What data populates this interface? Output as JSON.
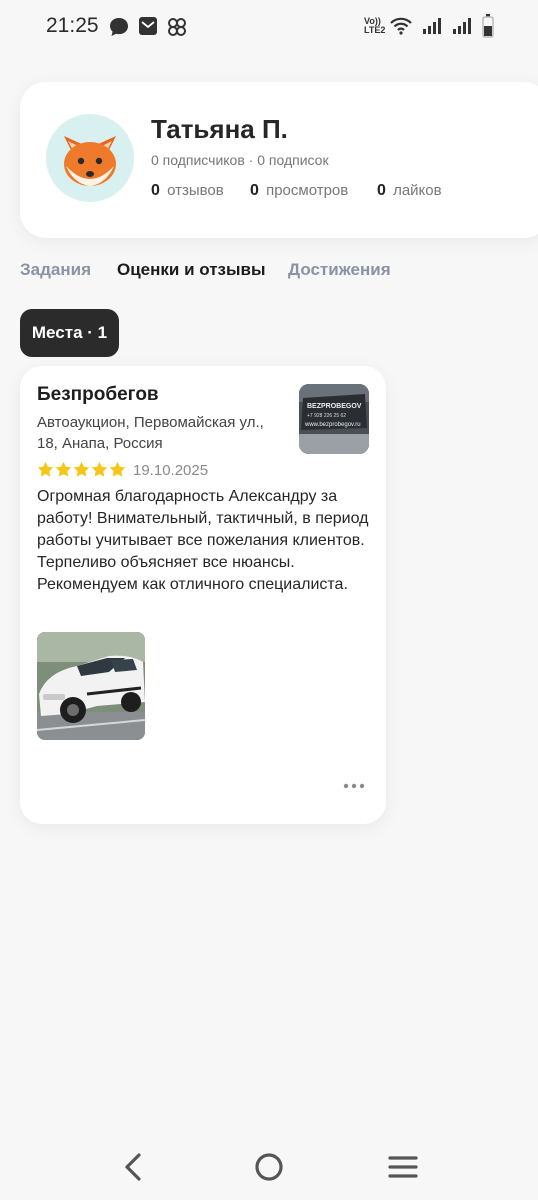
{
  "status_bar": {
    "time": "21:25",
    "left_icons": [
      "message-icon",
      "mail-icon",
      "app-icon"
    ],
    "right_icons": [
      "volte-icon",
      "wifi-icon",
      "signal-icon",
      "signal-icon",
      "battery-icon"
    ],
    "network_label_top": "Vo))",
    "network_label_bottom": "LTE2"
  },
  "profile": {
    "name": "Татьяна П.",
    "followers_line": "0 подписчиков · 0 подписок",
    "stats": [
      {
        "value": "0",
        "label": "отзывов"
      },
      {
        "value": "0",
        "label": "просмотров"
      },
      {
        "value": "0",
        "label": "лайков"
      }
    ],
    "avatar_icon": "fox-icon"
  },
  "tabs": [
    {
      "label": "Задания",
      "active": false
    },
    {
      "label": "Оценки и отзывы",
      "active": true
    },
    {
      "label": "Достижения",
      "active": false
    }
  ],
  "chip": {
    "label": "Места · 1"
  },
  "review": {
    "place_title": "Безпробегов",
    "address": "Автоаукцион, Первомайская ул., 18, Анапа, Россия",
    "rating": 5,
    "date": "19.10.2025",
    "text": "Огромная благодарность Александру за работу! Внимательный, тактичный, в период работы учитывает все пожелания клиентов. Терпеливо объясняет все нюансы. Рекомендуем как отличного специалиста.",
    "thumb_lines": [
      "BEZPROBEGOV",
      "+7 928 226 25 62",
      "www.bezprobegov.ru"
    ],
    "star_color": "#f5c518"
  },
  "nav": {
    "icons": [
      "back-icon",
      "home-icon",
      "menu-icon"
    ]
  }
}
